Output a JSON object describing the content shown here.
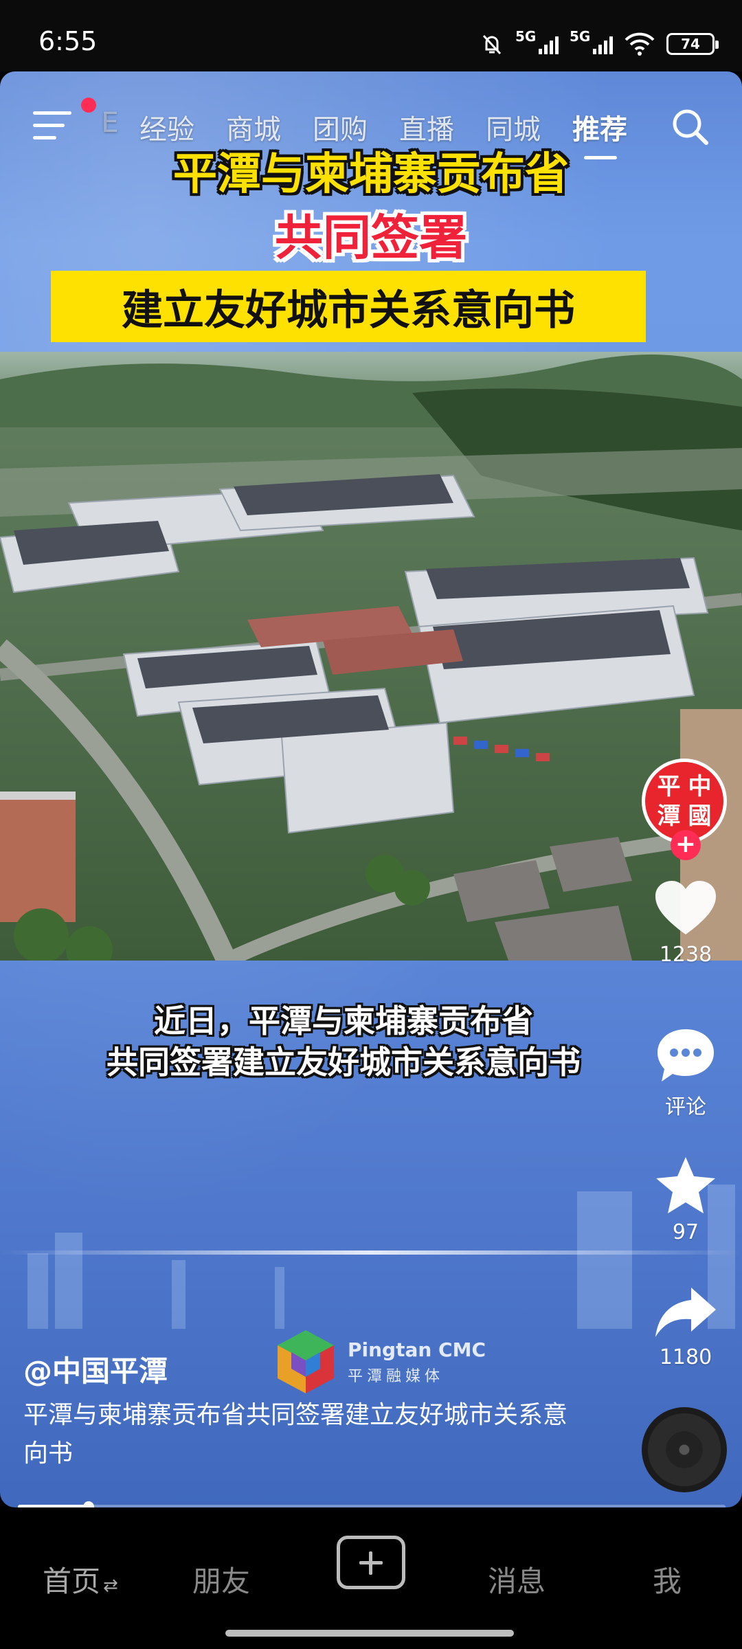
{
  "status_bar": {
    "time": "6:55",
    "signal1_label": "5G",
    "signal2_label": "5G",
    "battery": "74",
    "icons": [
      "mute-bell-icon",
      "signal-icon",
      "signal-icon",
      "wifi-icon",
      "battery-icon"
    ]
  },
  "top_nav": {
    "partial_tab": "E",
    "tabs": [
      "经验",
      "商城",
      "团购",
      "直播",
      "同城",
      "推荐"
    ],
    "active_tab": "推荐",
    "notification_dot_color": "#ff2d55"
  },
  "video": {
    "headline_line1": "平潭与柬埔寨贡布省",
    "headline_line2": "共同签署",
    "headline_line3": "建立友好城市关系意向书",
    "subtitle_line1": "近日，平潭与柬埔寨贡布省",
    "subtitle_line2": "共同签署建立友好城市关系意向书",
    "watermark_en": "Pingtan CMC",
    "watermark_cn": "平潭融媒体",
    "headline_color": "#ffe100",
    "accent_red": "#f0223a"
  },
  "right_rail": {
    "avatar_chars": [
      "平",
      "中",
      "潭",
      "國"
    ],
    "like_count": "1238",
    "comment_label": "评论",
    "favorite_count": "97",
    "share_count": "1180"
  },
  "info": {
    "author": "@中国平潭",
    "description": "平潭与柬埔寨贡布省共同签署建立友好城市关系意向书"
  },
  "playback": {
    "progress_fraction": 0.1
  },
  "bottom_nav": {
    "home": "首页",
    "friends": "朋友",
    "messages": "消息",
    "me": "我"
  }
}
